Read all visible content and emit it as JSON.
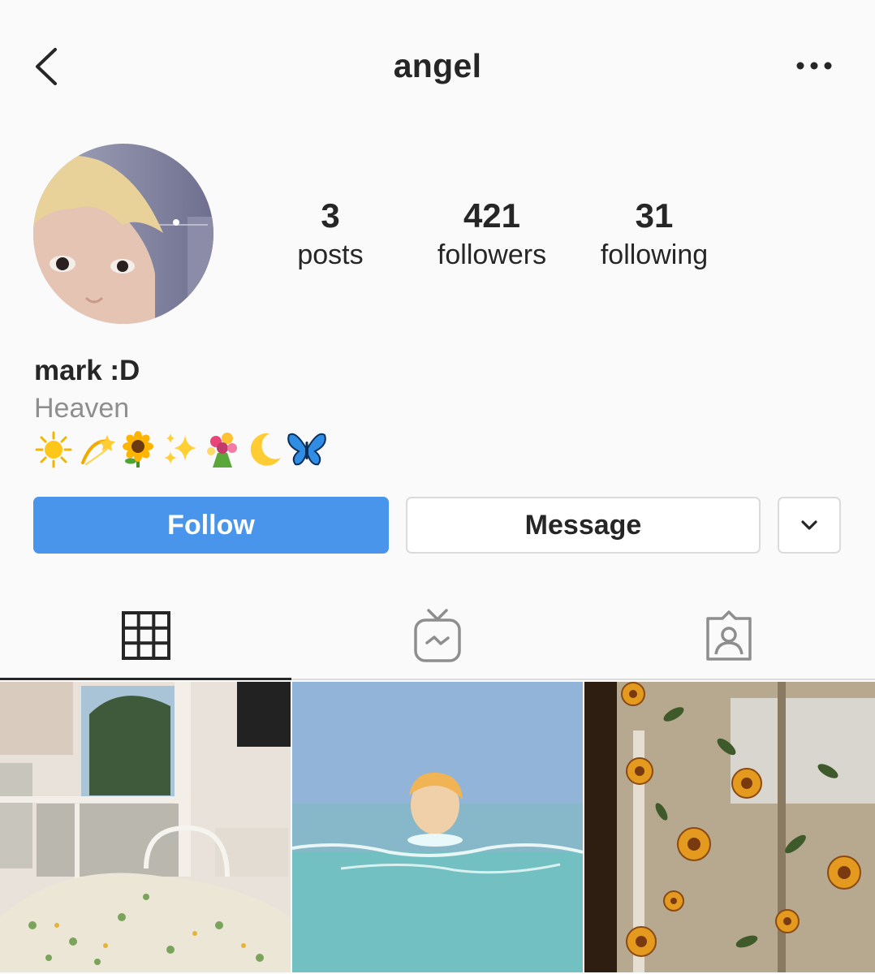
{
  "header": {
    "title": "angel",
    "back_icon": "chevron-left-icon",
    "more_icon": "ellipsis-icon"
  },
  "profile": {
    "stats": {
      "posts_count": "3",
      "posts_label": "posts",
      "followers_count": "421",
      "followers_label": "followers",
      "following_count": "31",
      "following_label": "following"
    },
    "bio": {
      "name": "mark :D",
      "category": "Heaven",
      "emojis": [
        "sun",
        "dizzy",
        "sunflower",
        "sparkles",
        "bouquet",
        "crescent-moon",
        "butterfly"
      ]
    }
  },
  "actions": {
    "follow_label": "Follow",
    "message_label": "Message",
    "dropdown_icon": "chevron-down-icon"
  },
  "tabs": [
    {
      "name": "grid",
      "icon": "grid-icon",
      "active": true
    },
    {
      "name": "igtv",
      "icon": "igtv-icon",
      "active": false
    },
    {
      "name": "tagged",
      "icon": "tagged-icon",
      "active": false
    }
  ],
  "colors": {
    "accent": "#4a95ec",
    "text": "#262626",
    "muted": "#8e8e8e",
    "border": "#dbdbdb"
  }
}
